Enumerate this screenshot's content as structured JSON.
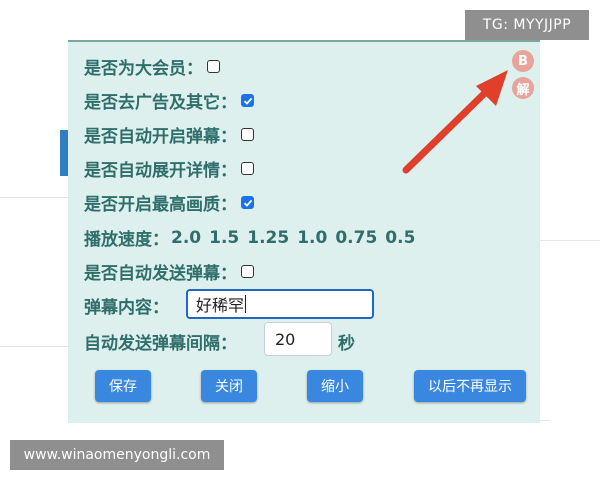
{
  "watermarks": {
    "tg": "TG: MYYJJPP",
    "site": "www.winaomenyongli.com"
  },
  "panel": {
    "options": [
      {
        "label": "是否为大会员：",
        "checked": false
      },
      {
        "label": "是否去广告及其它：",
        "checked": true
      },
      {
        "label": "是否自动开启弹幕：",
        "checked": false
      },
      {
        "label": "是否自动展开详情：",
        "checked": false
      },
      {
        "label": "是否开启最高画质：",
        "checked": true
      }
    ],
    "speed": {
      "label": "播放速度：",
      "values": [
        "2.0",
        "1.5",
        "1.25",
        "1.0",
        "0.75",
        "0.5"
      ]
    },
    "auto_danmaku": {
      "label": "是否自动发送弹幕：",
      "checked": false
    },
    "danmaku_content": {
      "label": "弹幕内容：",
      "value": "好稀罕"
    },
    "interval": {
      "label": "自动发送弹幕间隔：",
      "value": "20",
      "unit": "秒"
    },
    "buttons": {
      "save": "保存",
      "close": "关闭",
      "shrink": "缩小",
      "never_show": "以后不再显示"
    }
  },
  "corner_icons": {
    "b": "B",
    "jie": "解"
  },
  "colors": {
    "panel_bg": "#ddf0ee",
    "label_text": "#2f6e6a",
    "button_bg": "#3a87e0",
    "arrow": "#e0402b",
    "checkbox_checked": "#1a73e8"
  }
}
